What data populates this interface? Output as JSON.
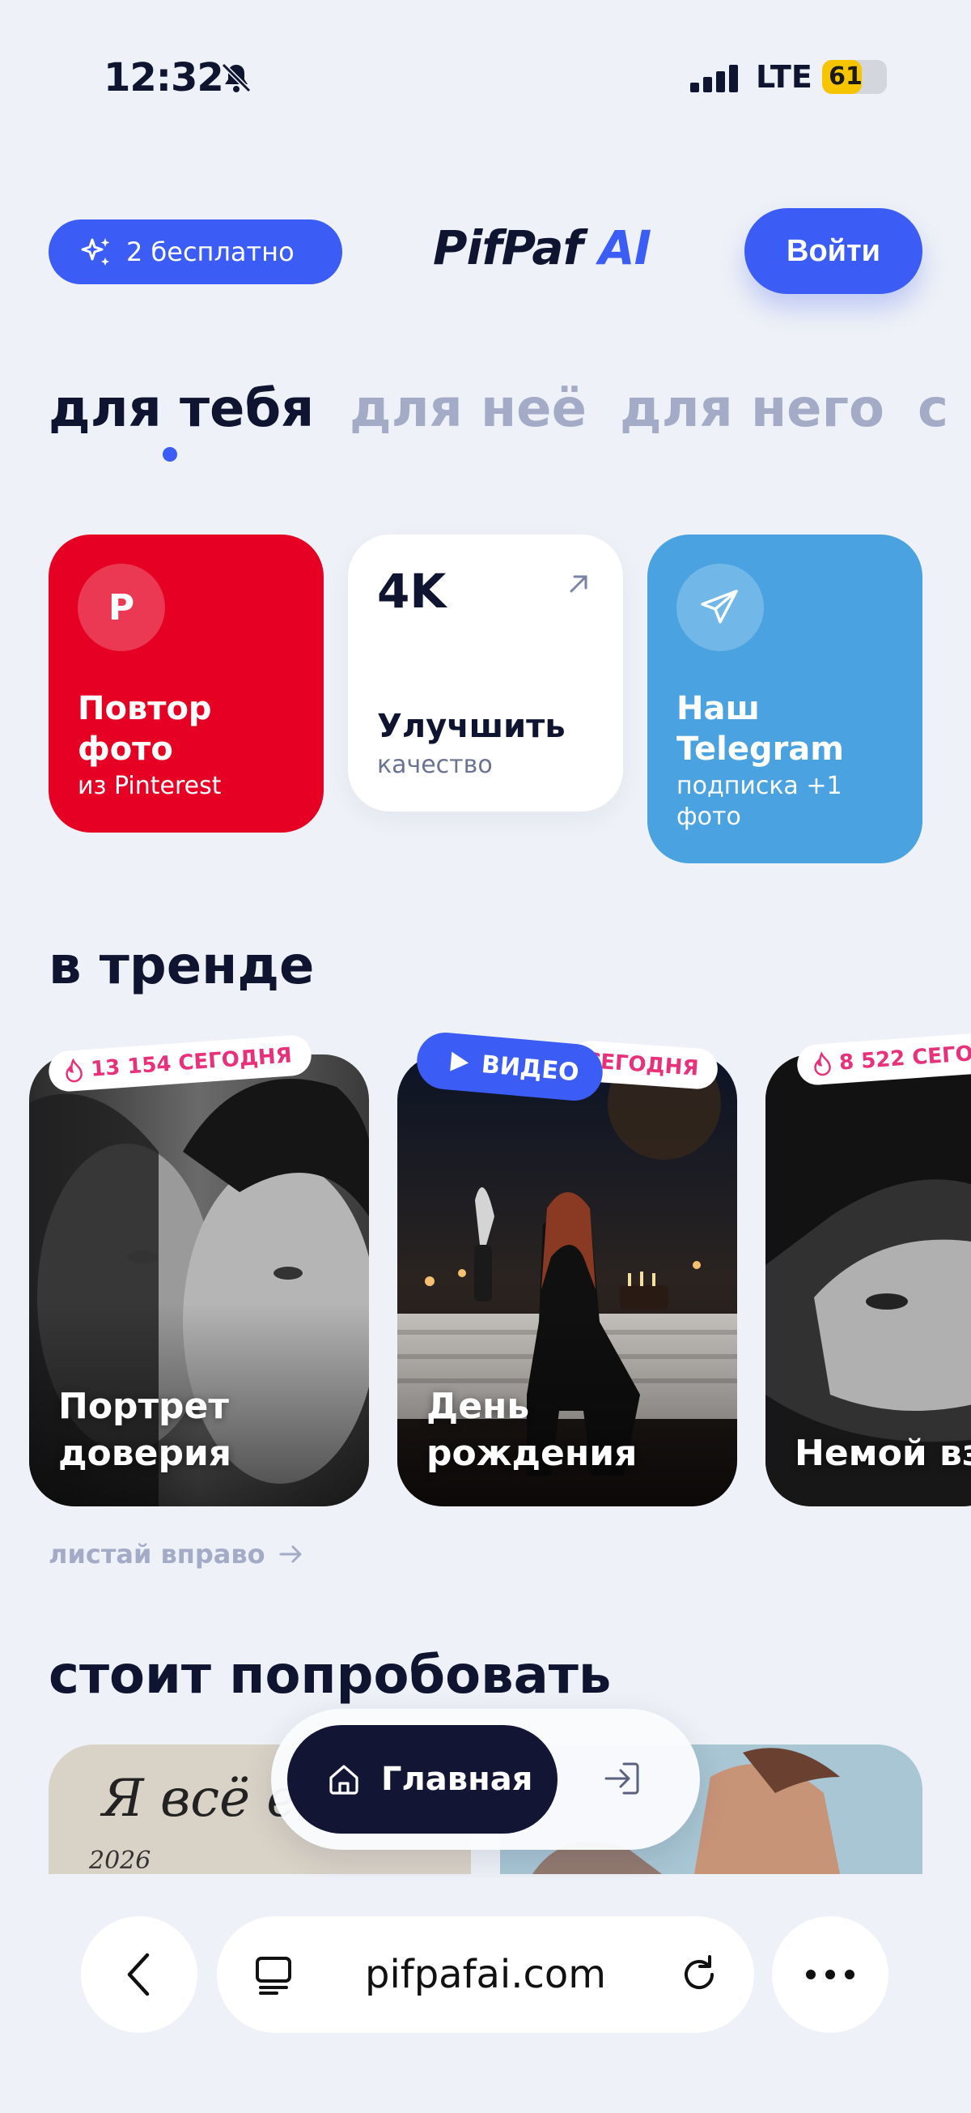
{
  "status_bar": {
    "time": "12:32",
    "network": "LTE",
    "battery": "61",
    "battery_level": 0.61
  },
  "header": {
    "free_label": "2 бесплатно",
    "logo_main": "PifPaf",
    "logo_ai": "AI",
    "login_label": "Войти"
  },
  "tabs": [
    {
      "label": "для тебя",
      "active": true
    },
    {
      "label": "для неё",
      "active": false
    },
    {
      "label": "для него",
      "active": false
    },
    {
      "label": "с",
      "active": false
    }
  ],
  "quick_cards": [
    {
      "icon_text": "P",
      "title": "Повтор фото",
      "subtitle": "из Pinterest",
      "color": "#e60023"
    },
    {
      "badge": "4K",
      "title": "Улучшить",
      "subtitle": "качество",
      "color": "#ffffff"
    },
    {
      "title": "Наш Telegram",
      "subtitle": "подписка +1 фото",
      "color": "#4aa3e0"
    }
  ],
  "trending": {
    "title": "в тренде",
    "cards": [
      {
        "label": "Портрет доверия",
        "badge": "13 154 СЕГОДНЯ"
      },
      {
        "label": "День рождения",
        "badge": "СЕГОДНЯ",
        "video_label": "ВИДЕО"
      },
      {
        "label": "Немой вз",
        "badge": "8 522 СЕГОД"
      }
    ],
    "swipe_hint": "листай вправо"
  },
  "try_section": {
    "title": "стоит попробовать",
    "card_text": "Я всё е",
    "card_year": "2026"
  },
  "bottom_nav": {
    "home_label": "Главная"
  },
  "browser": {
    "url": "pifpafai.com"
  }
}
